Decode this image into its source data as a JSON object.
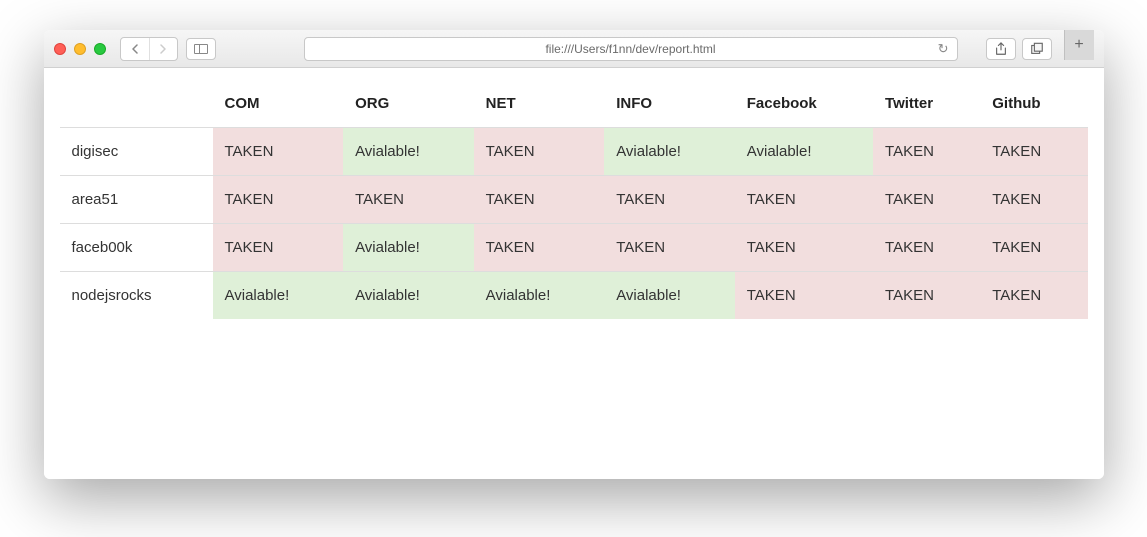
{
  "address_bar": {
    "url": "file:///Users/f1nn/dev/report.html"
  },
  "table": {
    "headers": [
      "",
      "COM",
      "ORG",
      "NET",
      "INFO",
      "Facebook",
      "Twitter",
      "Github"
    ],
    "rows": [
      {
        "name": "digisec",
        "cells": [
          {
            "text": "TAKEN",
            "status": "taken"
          },
          {
            "text": "Avialable!",
            "status": "avail"
          },
          {
            "text": "TAKEN",
            "status": "taken"
          },
          {
            "text": "Avialable!",
            "status": "avail"
          },
          {
            "text": "Avialable!",
            "status": "avail"
          },
          {
            "text": "TAKEN",
            "status": "taken"
          },
          {
            "text": "TAKEN",
            "status": "taken"
          }
        ]
      },
      {
        "name": "area51",
        "cells": [
          {
            "text": "TAKEN",
            "status": "taken"
          },
          {
            "text": "TAKEN",
            "status": "taken"
          },
          {
            "text": "TAKEN",
            "status": "taken"
          },
          {
            "text": "TAKEN",
            "status": "taken"
          },
          {
            "text": "TAKEN",
            "status": "taken"
          },
          {
            "text": "TAKEN",
            "status": "taken"
          },
          {
            "text": "TAKEN",
            "status": "taken"
          }
        ]
      },
      {
        "name": "faceb00k",
        "cells": [
          {
            "text": "TAKEN",
            "status": "taken"
          },
          {
            "text": "Avialable!",
            "status": "avail"
          },
          {
            "text": "TAKEN",
            "status": "taken"
          },
          {
            "text": "TAKEN",
            "status": "taken"
          },
          {
            "text": "TAKEN",
            "status": "taken"
          },
          {
            "text": "TAKEN",
            "status": "taken"
          },
          {
            "text": "TAKEN",
            "status": "taken"
          }
        ]
      },
      {
        "name": "nodejsrocks",
        "cells": [
          {
            "text": "Avialable!",
            "status": "avail"
          },
          {
            "text": "Avialable!",
            "status": "avail"
          },
          {
            "text": "Avialable!",
            "status": "avail"
          },
          {
            "text": "Avialable!",
            "status": "avail"
          },
          {
            "text": "TAKEN",
            "status": "taken"
          },
          {
            "text": "TAKEN",
            "status": "taken"
          },
          {
            "text": "TAKEN",
            "status": "taken"
          }
        ]
      }
    ]
  }
}
